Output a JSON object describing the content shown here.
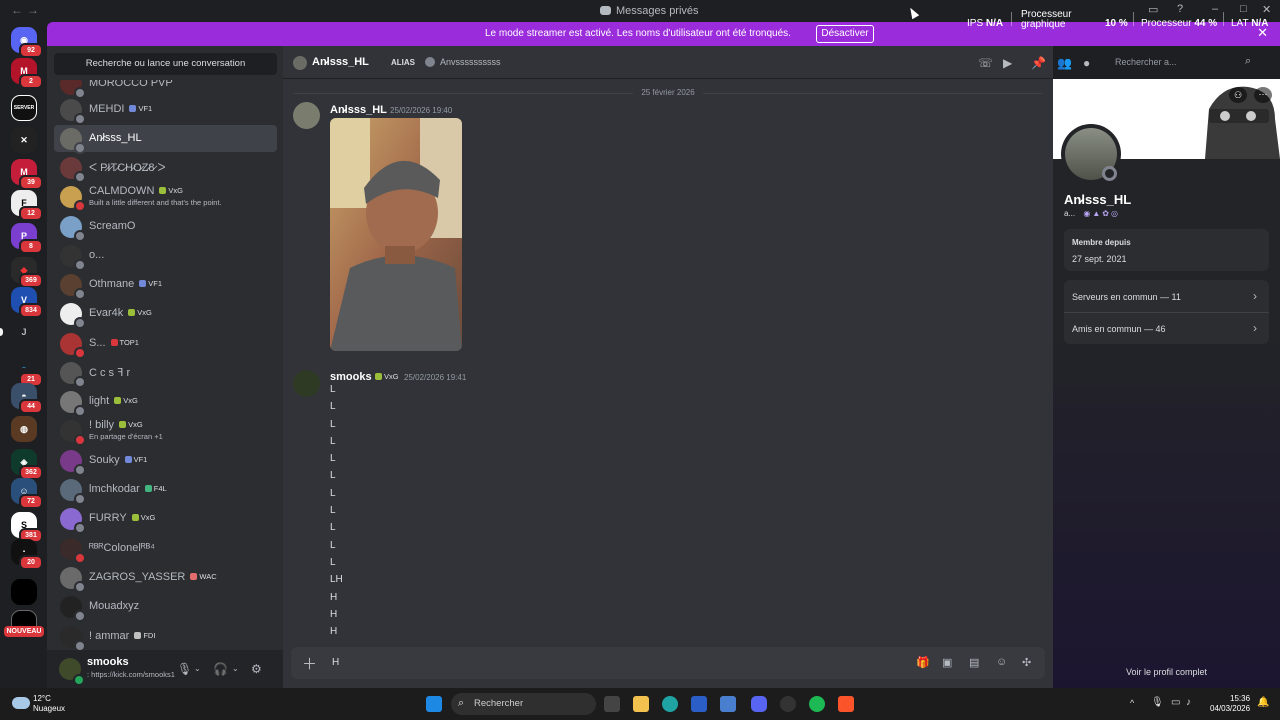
{
  "titlebar": {
    "title": "Messages privés",
    "back": "←",
    "forward": "→"
  },
  "streamer_banner": {
    "text": "Le mode streamer est activé. Les noms d'utilisateur ont été tronqués.",
    "button": "Désactiver",
    "close": "✕"
  },
  "perf_overlay": {
    "ips_label": "IPS",
    "ips_value": "N/A",
    "gpu_label_1": "Processeur",
    "gpu_label_2": "graphique",
    "gpu_value": "10 %",
    "cpu_label": "Processeur",
    "cpu_value": "44 %",
    "lat_label": "LAT",
    "lat_value": "N/A"
  },
  "servers": {
    "badges": [
      "92",
      "2",
      "39",
      "12",
      "8",
      "369",
      "834",
      "21",
      "44",
      "362",
      "72",
      "381",
      "20"
    ],
    "home_letter": "J",
    "nouveau": "NOUVEAU"
  },
  "dm": {
    "search_placeholder": "Recherche ou lance une conversation",
    "items": [
      {
        "name": "MOROCCO PVP",
        "tag": "",
        "sub": ""
      },
      {
        "name": "MEHDI",
        "tag": "VF1",
        "sub": ""
      },
      {
        "name": "An̷lsss_HL",
        "tag": "",
        "sub": ""
      },
      {
        "name": "ᐸ P̷I̷T̷C̷H̷O̷Z̷8̷ ᐳ",
        "tag": "",
        "sub": ""
      },
      {
        "name": "CALMDOWN",
        "tag": "VxG",
        "sub": "Built a little different and that's the point."
      },
      {
        "name": "ScreamO",
        "tag": "",
        "sub": ""
      },
      {
        "name": "o...",
        "tag": "",
        "sub": ""
      },
      {
        "name": "Othmane",
        "tag": "VF1",
        "sub": ""
      },
      {
        "name": "Evar4k",
        "tag": "VxG",
        "sub": ""
      },
      {
        "name": "S...",
        "tag": "TOP1",
        "sub": ""
      },
      {
        "name": "C c s ꟻ r",
        "tag": "",
        "sub": ""
      },
      {
        "name": "light",
        "tag": "VxG",
        "sub": ""
      },
      {
        "name": "! billy",
        "tag": "VxG",
        "sub": "En partage d'écran +1"
      },
      {
        "name": "Souky",
        "tag": "VF1",
        "sub": ""
      },
      {
        "name": "lmchkodar",
        "tag": "F4L",
        "sub": ""
      },
      {
        "name": "FURRY",
        "tag": "VxG",
        "sub": ""
      },
      {
        "name": "ᴿᴮᴿColonelᴿᴮ⁴",
        "tag": "",
        "sub": ""
      },
      {
        "name": "ZAGROS_YASSER",
        "tag": "WAC",
        "sub": ""
      },
      {
        "name": "Mouadxyz",
        "tag": "",
        "sub": ""
      },
      {
        "name": "! ammar",
        "tag": "FDI",
        "sub": ""
      }
    ]
  },
  "current_user": {
    "name": "smooks",
    "status": ": https://kick.com/smooks1"
  },
  "chat": {
    "channel_name": "An̷lsss_HL",
    "alias_label": "ALIAS",
    "alias_value": "Anvssssssssss",
    "search_placeholder": "Rechercher a...",
    "date_divider": "25 février 2026",
    "messages": [
      {
        "author": "An̷lsss_HL",
        "time": "25/02/2026 19:40",
        "tag": ""
      },
      {
        "author": "smooks",
        "time": "25/02/2026 19:41",
        "tag": "VxG"
      }
    ],
    "lines": [
      "L",
      "L",
      "L",
      "L",
      "L",
      "L",
      "L",
      "L",
      "L",
      "L",
      "L",
      "LH",
      "H",
      "H",
      "H"
    ],
    "composer_value": "H"
  },
  "profile": {
    "name": "An̷lsss_HL",
    "sub": "a...",
    "member_since_label": "Membre depuis",
    "member_since_value": "27 sept. 2021",
    "servers_common": "Serveurs en commun — 11",
    "friends_common": "Amis en commun — 46",
    "view_full": "Voir le profil complet"
  },
  "taskbar": {
    "weather_temp": "12°C",
    "weather_desc": "Nuageux",
    "search_placeholder": "Rechercher",
    "time": "15:36",
    "date": "04/03/2026"
  },
  "colors": {
    "accent": "#9b2cdc",
    "badge": "#da373c",
    "online": "#23a55a",
    "offline": "#80848e"
  }
}
